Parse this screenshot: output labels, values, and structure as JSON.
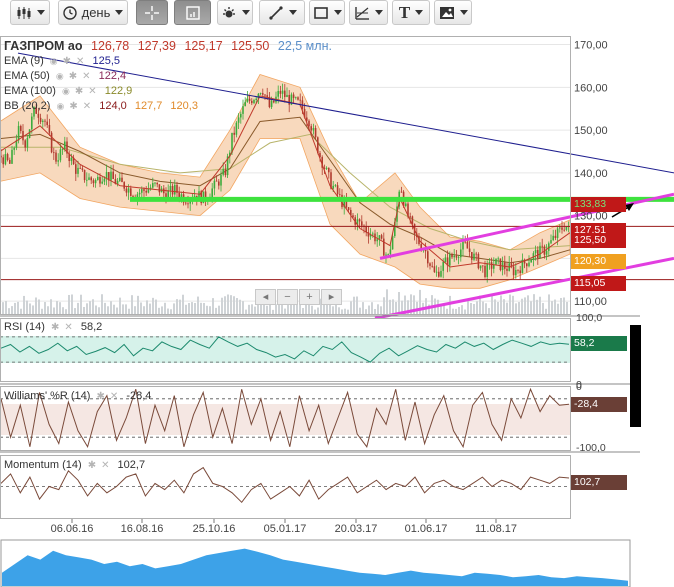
{
  "toolbar": {
    "timeframe_label": "день"
  },
  "legend": {
    "ticker": "ГАЗПРОМ ао",
    "open": "126,78",
    "high": "127,39",
    "low": "125,17",
    "close": "125,50",
    "volume": "22,5 млн.",
    "ema9_label": "EMA (9)",
    "ema9_value": "125,5",
    "ema50_label": "EMA (50)",
    "ema50_value": "122,4",
    "ema100_label": "EMA (100)",
    "ema100_value": "122,9",
    "bb_label": "BB (20,2)",
    "bb_mid": "124,0",
    "bb_upper": "127,7",
    "bb_lower": "120,3",
    "rsi_label": "RSI (14)",
    "rsi_value": "58,2",
    "willr_label": "Williams' %R (14)",
    "willr_value": "-28,4",
    "mom_label": "Momentum (14)",
    "mom_value": "102,7"
  },
  "badges": {
    "green": "133,83",
    "red1": "127,51",
    "red2": "125,50",
    "orange": "120,30",
    "red3": "115,05",
    "rsi": "58,2",
    "willr": "-28,4",
    "mom": "102,7"
  },
  "colors": {
    "candle_up": "#3cab3c",
    "candle_down": "#b03a2e",
    "bb_fill": "#f8d9bd",
    "bb_line": "#f2a560",
    "ema9": "#c0392b",
    "ema50": "#8a5a2b",
    "ema100": "#b8b46a",
    "trend_blue": "#1f1f8f",
    "support_green": "#3ee23e",
    "channel_magenta": "#e23ee0",
    "rsi_line": "#1d8a6e",
    "rsi_fill": "#d6f2ea",
    "willr_line": "#7a4a3a",
    "willr_fill": "#f5e7e3",
    "mom_line": "#7a4a3a",
    "badge_green": "#1a7a4a",
    "badge_red": "#c01818",
    "badge_orange": "#f0a020",
    "badge_brown": "#6a3f36",
    "volume_area": "#3da2e8"
  },
  "chart_data": [
    {
      "type": "candlestick",
      "title": "ГАЗПРОМ ао",
      "x_ticks": [
        "06.06.16",
        "16.08.16",
        "25.10.16",
        "05.01.17",
        "20.03.17",
        "01.06.17",
        "11.08.17"
      ],
      "y_ticks": [
        "110,00",
        "120,00",
        "130,00",
        "140,00",
        "150,00",
        "160,00",
        "170,00"
      ],
      "ylim": [
        107,
        172
      ],
      "price_path": [
        [
          0,
          144
        ],
        [
          10,
          142
        ],
        [
          18,
          150
        ],
        [
          25,
          147
        ],
        [
          35,
          155
        ],
        [
          45,
          152
        ],
        [
          55,
          143
        ],
        [
          65,
          146
        ],
        [
          75,
          141
        ],
        [
          85,
          139
        ],
        [
          95,
          138
        ],
        [
          105,
          140
        ],
        [
          115,
          138
        ],
        [
          125,
          137
        ],
        [
          135,
          135
        ],
        [
          145,
          136
        ],
        [
          155,
          137
        ],
        [
          165,
          135
        ],
        [
          175,
          136
        ],
        [
          185,
          134
        ],
        [
          195,
          135
        ],
        [
          205,
          134
        ],
        [
          215,
          137
        ],
        [
          225,
          140
        ],
        [
          232,
          148
        ],
        [
          238,
          152
        ],
        [
          245,
          156
        ],
        [
          255,
          158
        ],
        [
          262,
          160
        ],
        [
          270,
          155
        ],
        [
          280,
          159
        ],
        [
          290,
          157
        ],
        [
          300,
          156
        ],
        [
          310,
          152
        ],
        [
          320,
          144
        ],
        [
          330,
          138
        ],
        [
          340,
          134
        ],
        [
          350,
          130
        ],
        [
          360,
          128
        ],
        [
          370,
          126
        ],
        [
          380,
          124
        ],
        [
          388,
          120
        ],
        [
          395,
          128
        ],
        [
          400,
          138
        ],
        [
          405,
          132
        ],
        [
          415,
          125
        ],
        [
          425,
          122
        ],
        [
          435,
          116
        ],
        [
          445,
          119
        ],
        [
          455,
          121
        ],
        [
          465,
          123
        ],
        [
          475,
          120
        ],
        [
          485,
          117
        ],
        [
          495,
          119
        ],
        [
          505,
          118
        ],
        [
          515,
          117
        ],
        [
          525,
          119
        ],
        [
          535,
          121
        ],
        [
          545,
          122
        ],
        [
          555,
          125
        ],
        [
          565,
          128
        ],
        [
          570,
          126
        ]
      ],
      "bb_upper": [
        [
          0,
          152
        ],
        [
          40,
          158
        ],
        [
          80,
          146
        ],
        [
          120,
          142
        ],
        [
          160,
          140
        ],
        [
          200,
          139
        ],
        [
          230,
          150
        ],
        [
          260,
          163
        ],
        [
          300,
          160
        ],
        [
          330,
          145
        ],
        [
          360,
          133
        ],
        [
          395,
          140
        ],
        [
          420,
          132
        ],
        [
          450,
          125
        ],
        [
          480,
          124
        ],
        [
          510,
          122
        ],
        [
          540,
          126
        ],
        [
          570,
          129
        ]
      ],
      "bb_lower": [
        [
          0,
          138
        ],
        [
          40,
          140
        ],
        [
          80,
          134
        ],
        [
          120,
          132
        ],
        [
          160,
          131
        ],
        [
          200,
          130
        ],
        [
          230,
          136
        ],
        [
          260,
          148
        ],
        [
          300,
          148
        ],
        [
          330,
          128
        ],
        [
          360,
          121
        ],
        [
          395,
          118
        ],
        [
          420,
          114
        ],
        [
          450,
          113
        ],
        [
          480,
          113
        ],
        [
          510,
          115
        ],
        [
          540,
          118
        ],
        [
          570,
          121
        ]
      ],
      "ema9": [
        [
          0,
          145
        ],
        [
          40,
          151
        ],
        [
          80,
          142
        ],
        [
          120,
          137
        ],
        [
          160,
          136
        ],
        [
          200,
          135
        ],
        [
          230,
          144
        ],
        [
          260,
          158
        ],
        [
          300,
          156
        ],
        [
          330,
          137
        ],
        [
          360,
          127
        ],
        [
          390,
          123
        ],
        [
          400,
          134
        ],
        [
          420,
          124
        ],
        [
          450,
          118
        ],
        [
          480,
          119
        ],
        [
          510,
          118
        ],
        [
          540,
          121
        ],
        [
          570,
          126
        ]
      ],
      "ema50": [
        [
          0,
          148
        ],
        [
          40,
          149
        ],
        [
          80,
          145
        ],
        [
          120,
          140
        ],
        [
          160,
          138
        ],
        [
          200,
          137
        ],
        [
          230,
          141
        ],
        [
          260,
          152
        ],
        [
          300,
          153
        ],
        [
          330,
          143
        ],
        [
          360,
          133
        ],
        [
          390,
          128
        ],
        [
          420,
          125
        ],
        [
          450,
          121
        ],
        [
          480,
          120
        ],
        [
          510,
          119
        ],
        [
          540,
          120
        ],
        [
          570,
          122
        ]
      ],
      "ema100": [
        [
          0,
          146
        ],
        [
          60,
          146
        ],
        [
          120,
          142
        ],
        [
          180,
          140
        ],
        [
          230,
          141
        ],
        [
          270,
          147
        ],
        [
          310,
          149
        ],
        [
          350,
          140
        ],
        [
          390,
          132
        ],
        [
          430,
          127
        ],
        [
          470,
          124
        ],
        [
          510,
          122
        ],
        [
          570,
          123
        ]
      ],
      "trend_line": [
        [
          18,
          168
        ],
        [
          674,
          140
        ]
      ],
      "support_line": [
        [
          130,
          133.8
        ],
        [
          674,
          133.8
        ]
      ],
      "red_lines": [
        127.5,
        115.05
      ],
      "channel_upper": [
        [
          380,
          120
        ],
        [
          674,
          135
        ]
      ],
      "channel_lower": [
        [
          375,
          106
        ],
        [
          674,
          120
        ]
      ]
    },
    {
      "type": "line",
      "title": "RSI (14)",
      "y_ticks": [
        "100,0",
        "0"
      ],
      "ylim": [
        0,
        100
      ],
      "levels": [
        70,
        30
      ],
      "values": [
        52,
        58,
        46,
        55,
        44,
        50,
        60,
        48,
        55,
        42,
        47,
        53,
        45,
        58,
        40,
        52,
        48,
        62,
        55,
        50,
        65,
        58,
        52,
        70,
        62,
        55,
        60,
        50,
        45,
        38,
        42,
        35,
        48,
        40,
        55,
        50,
        62,
        45,
        38,
        30,
        44,
        52,
        40,
        48,
        56,
        50,
        46,
        58,
        52,
        62,
        55,
        60,
        50,
        58,
        65,
        60,
        55,
        62,
        58,
        60,
        58.2
      ]
    },
    {
      "type": "line",
      "title": "Williams' %R (14)",
      "y_ticks": [
        "0",
        "-100,0"
      ],
      "ylim": [
        -100,
        0
      ],
      "levels": [
        -20,
        -80
      ],
      "values": [
        -20,
        -80,
        -30,
        -95,
        -10,
        -60,
        -90,
        -25,
        -70,
        -95,
        -40,
        -15,
        -85,
        -50,
        -5,
        -90,
        -30,
        -70,
        -15,
        -95,
        -45,
        -10,
        -80,
        -35,
        -90,
        -5,
        -60,
        -20,
        -85,
        -40,
        -95,
        -15,
        -70,
        -30,
        -90,
        -50,
        -10,
        -75,
        -95,
        -35,
        -60,
        -5,
        -85,
        -25,
        -90,
        -45,
        -15,
        -70,
        -95,
        -30,
        -10,
        -60,
        -85,
        -20,
        -50,
        -5,
        -40,
        -15,
        -30,
        -28.4
      ]
    },
    {
      "type": "line",
      "title": "Momentum (14)",
      "ylim": [
        90,
        110
      ],
      "levels": [
        100
      ],
      "values": [
        101,
        104,
        98,
        103,
        96,
        100,
        99,
        105,
        102,
        97,
        101,
        98,
        100,
        103,
        104,
        97,
        101,
        99,
        102,
        98,
        104,
        106,
        101,
        100,
        98,
        95,
        99,
        101,
        96,
        98,
        100,
        97,
        102,
        96,
        99,
        101,
        103,
        98,
        100,
        102,
        99,
        101,
        100,
        103,
        98,
        101,
        102,
        100,
        99,
        101,
        103,
        100,
        102,
        101,
        99,
        103,
        102,
        101,
        103,
        102.7
      ]
    },
    {
      "type": "area",
      "title": "",
      "values": [
        0.3,
        0.5,
        0.7,
        0.6,
        0.8,
        0.7,
        0.65,
        0.6,
        0.5,
        0.55,
        0.45,
        0.5,
        0.4,
        0.45,
        0.5,
        0.6,
        0.7,
        0.75,
        0.8,
        0.85,
        0.78,
        0.7,
        0.6,
        0.55,
        0.5,
        0.45,
        0.4,
        0.35,
        0.3,
        0.28,
        0.25,
        0.3,
        0.35,
        0.3,
        0.28,
        0.25,
        0.22,
        0.3,
        0.28,
        0.25,
        0.2,
        0.22,
        0.25,
        0.2,
        0.18,
        0.22,
        0.2,
        0.18,
        0.15,
        0.12
      ]
    }
  ]
}
